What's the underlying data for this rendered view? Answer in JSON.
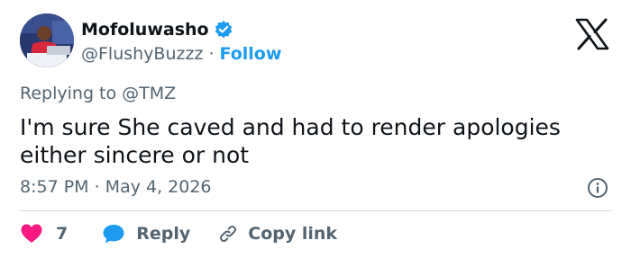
{
  "author": {
    "display_name": "Mofoluwasho",
    "handle": "@FlushyBuzzz",
    "separator": "·",
    "follow_label": "Follow",
    "verified": true
  },
  "tweet": {
    "replying_to": "Replying to @TMZ",
    "text": "I'm sure She caved and had to render apologies either sincere or not",
    "timestamp": "8:57 PM · May 4, 2026"
  },
  "actions": {
    "like_count": "7",
    "reply_label": "Reply",
    "copy_link_label": "Copy link"
  },
  "icons": {
    "verified": "verified-badge-icon",
    "brand": "x-logo-icon",
    "info": "info-icon",
    "like": "heart-icon",
    "reply": "reply-bubble-icon",
    "copy_link": "link-icon"
  },
  "colors": {
    "accent": "#1d9bf0",
    "like": "#f91880",
    "secondary_text": "#536471",
    "primary_text": "#0f1419",
    "divider": "#cfd9de"
  }
}
